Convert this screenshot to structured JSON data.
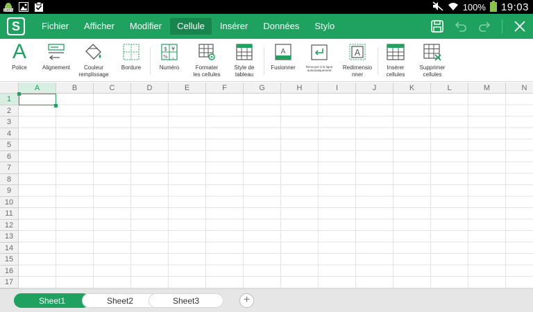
{
  "status_bar": {
    "battery_percent": "100%",
    "time": "19:03",
    "left_icons": [
      "android-debug-icon",
      "image-icon",
      "clipboard-check-icon"
    ],
    "right_icons": [
      "mute-icon",
      "wifi-icon",
      "battery-icon"
    ]
  },
  "menu": {
    "logo_letter": "S",
    "items": [
      {
        "label": "Fichier",
        "active": false
      },
      {
        "label": "Afficher",
        "active": false
      },
      {
        "label": "Modifier",
        "active": false
      },
      {
        "label": "Cellule",
        "active": true
      },
      {
        "label": "Insérer",
        "active": false
      },
      {
        "label": "Données",
        "active": false
      },
      {
        "label": "Stylo",
        "active": false
      }
    ],
    "actions": [
      "save-icon",
      "undo-icon",
      "redo-icon",
      "close-icon"
    ]
  },
  "ribbon": {
    "font": "Police",
    "alignment": "Alignement",
    "fill_color_1": "Couleur",
    "fill_color_2": "remplissage",
    "border": "Bordure",
    "number": "Numéro",
    "format_cells_1": "Formater",
    "format_cells_2": "les cellules",
    "table_style_1": "Style de",
    "table_style_2": "tableau",
    "merge": "Fusionner",
    "wrap_1": "Renvoyer à la ligne",
    "wrap_2": "automatiquement",
    "resize_1": "Redimensio",
    "resize_2": "nner",
    "insert_cells_1": "Insérer",
    "insert_cells_2": "cellules",
    "delete_cells_1": "Supprimer",
    "delete_cells_2": "cellules",
    "font_glyph": "A"
  },
  "grid": {
    "columns": [
      "A",
      "B",
      "C",
      "D",
      "E",
      "F",
      "G",
      "H",
      "I",
      "J",
      "K",
      "L",
      "M",
      "N"
    ],
    "rows": [
      "1",
      "2",
      "3",
      "4",
      "5",
      "6",
      "7",
      "8",
      "9",
      "10",
      "11",
      "12",
      "13",
      "14",
      "15",
      "16",
      "17"
    ],
    "active_cell": "A1"
  },
  "sheets": {
    "tabs": [
      {
        "label": "Sheet1",
        "active": true
      },
      {
        "label": "Sheet2",
        "active": false
      },
      {
        "label": "Sheet3",
        "active": false
      }
    ],
    "add_label": "+"
  },
  "colors": {
    "accent": "#1fa160",
    "accent_dark": "#17854d"
  }
}
